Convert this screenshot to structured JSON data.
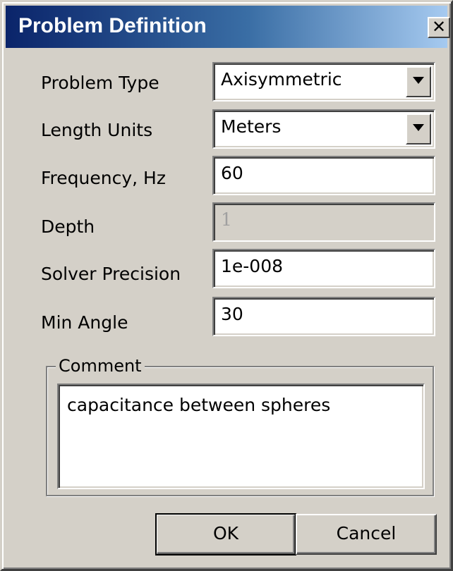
{
  "dialog": {
    "title": "Problem Definition",
    "close_glyph": "✕"
  },
  "form": {
    "problem_type": {
      "label": "Problem Type",
      "value": "Axisymmetric"
    },
    "length_units": {
      "label": "Length Units",
      "value": "Meters"
    },
    "frequency": {
      "label": "Frequency, Hz",
      "value": "60"
    },
    "depth": {
      "label": "Depth",
      "value": "1"
    },
    "solver_precision": {
      "label": "Solver Precision",
      "value": "1e-008"
    },
    "min_angle": {
      "label": "Min Angle",
      "value": "30"
    }
  },
  "comment": {
    "label": "Comment",
    "value": "capacitance between spheres"
  },
  "buttons": {
    "ok": "OK",
    "cancel": "Cancel"
  },
  "icons": {
    "close": "close-icon",
    "dropdown": "chevron-down-icon"
  },
  "colors": {
    "titlebar_start": "#0a246a",
    "titlebar_end": "#a6caf0",
    "face": "#d4d0c8"
  }
}
